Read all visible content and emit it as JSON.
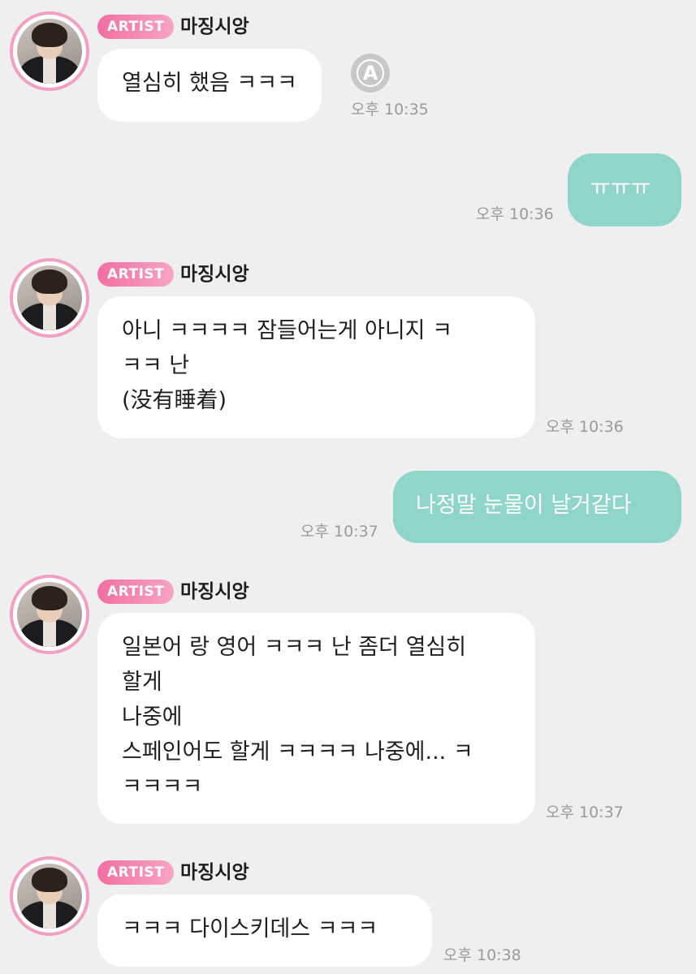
{
  "artist": {
    "badge": "ARTIST",
    "name": "마징시앙"
  },
  "icons": {
    "avatar": "artist-avatar-photo",
    "translate": "translate-a-icon"
  },
  "colors": {
    "background": "#efefef",
    "incoming_bubble": "#ffffff",
    "outgoing_bubble": "#8fd5c9",
    "badge_start": "#f16fa0",
    "badge_end": "#f8a5c4",
    "timestamp": "#9a9a9a"
  },
  "translate_button": {
    "label": "A"
  },
  "messages": [
    {
      "sender": "artist",
      "lines": [
        "열심히 했음 ㅋㅋㅋ"
      ],
      "time": "오후 10:35"
    },
    {
      "sender": "me",
      "lines": [
        "ㅠㅠㅠ"
      ],
      "time": "오후 10:36"
    },
    {
      "sender": "artist",
      "lines": [
        "아니 ㅋㅋㅋㅋ 잠들어는게 아니지 ㅋ",
        "ㅋㅋ 난",
        "(没有睡着)"
      ],
      "time": "오후 10:36"
    },
    {
      "sender": "me",
      "lines": [
        "나정말 눈물이 날거같다"
      ],
      "time": "오후 10:37"
    },
    {
      "sender": "artist",
      "lines": [
        "일본어 랑 영어 ㅋㅋㅋ 난 좀더 열심히",
        "할게",
        "나중에",
        "스페인어도 할게 ㅋㅋㅋㅋ 나중에... ㅋ",
        "ㅋㅋㅋㅋ"
      ],
      "time": "오후 10:37"
    },
    {
      "sender": "artist",
      "lines": [
        "ㅋㅋㅋ 다이스키데스 ㅋㅋㅋ"
      ],
      "time": "오후 10:38"
    }
  ]
}
